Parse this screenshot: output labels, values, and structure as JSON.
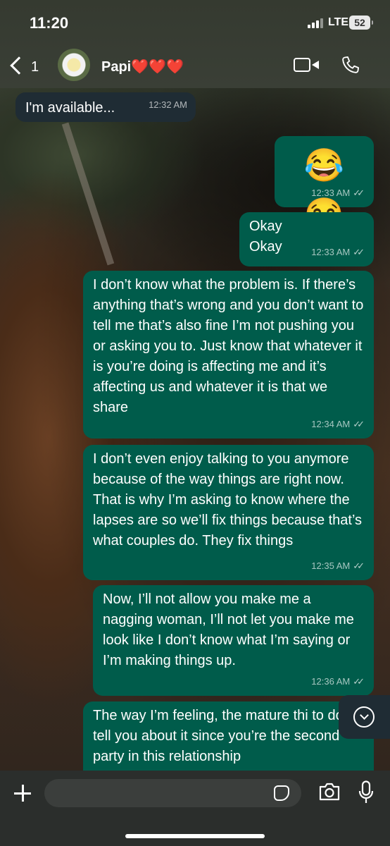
{
  "status_bar": {
    "time": "11:20",
    "network": "LTE",
    "battery": "52"
  },
  "header": {
    "back_count": "1",
    "contact_name": "Papi❤️❤️❤️",
    "avatar_icon": "flower-avatar",
    "video_call_icon": "video-camera-icon",
    "voice_call_icon": "phone-icon"
  },
  "messages": [
    {
      "direction": "incoming",
      "text": "I'm available...",
      "time": "12:32 AM"
    },
    {
      "direction": "outgoing",
      "text": "😂 😂",
      "time": "12:33 AM",
      "status": "read"
    },
    {
      "direction": "outgoing",
      "text": "Okay\nOkay",
      "time": "12:33 AM",
      "status": "read"
    },
    {
      "direction": "outgoing",
      "text": "I don’t know what the problem is. If there’s anything that’s wrong and you don’t want to tell me that’s also fine I’m not pushing you or asking you to. Just know that whatever it is you’re doing is affecting me and it’s affecting us and whatever it is that we share",
      "time": "12:34 AM",
      "status": "read"
    },
    {
      "direction": "outgoing",
      "text": "I don’t even enjoy talking to you anymore because of the way things are right now. That is why I’m asking to know where the lapses are so we’ll fix things because that’s what couples do. They fix things",
      "time": "12:35 AM",
      "status": "read"
    },
    {
      "direction": "outgoing",
      "text": "Now, I’ll not allow you make me a nagging woman, I’ll not let you make me look like I don’t know what I’m saying or I’m making things up.",
      "time": "12:36 AM",
      "status": "read"
    },
    {
      "direction": "outgoing",
      "text": "The way I’m feeling, the mature thi to do is tell you about it since you’re the second party in this relationship",
      "time": "",
      "status": ""
    }
  ],
  "ticks_glyph": "✓✓",
  "input": {
    "placeholder": "",
    "value": ""
  },
  "colors": {
    "outgoing_bubble": "#005c4b",
    "incoming_bubble": "#1f2c34",
    "input_bar": "#2b2e2c"
  }
}
